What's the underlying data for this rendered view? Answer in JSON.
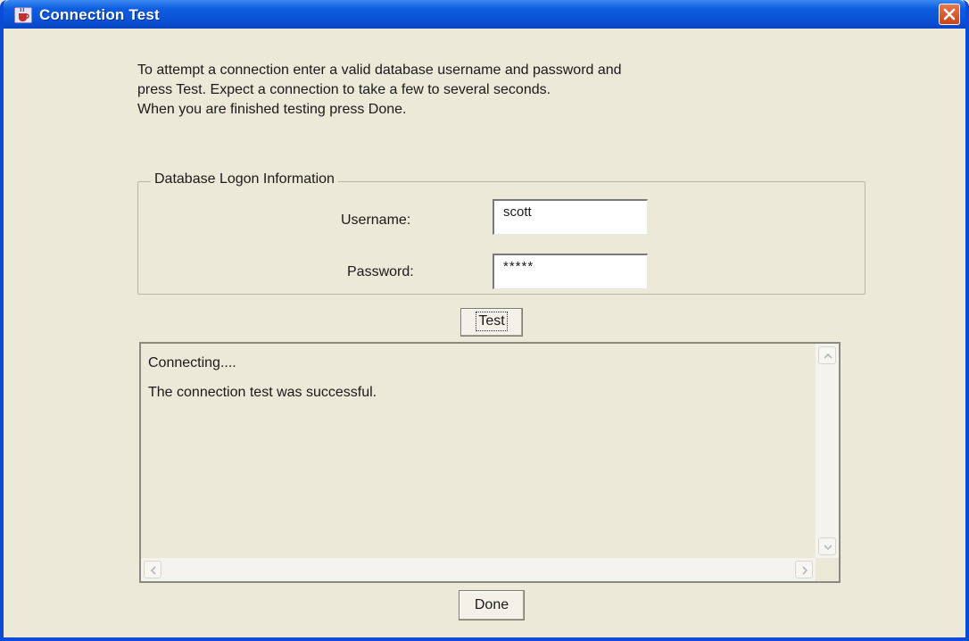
{
  "window": {
    "title": "Connection Test",
    "icons": {
      "app": "java-cup-icon",
      "close": "close-x-icon"
    },
    "colors": {
      "titlebar": "#0A52D6",
      "close": "#D5552B",
      "background": "#ECE9D8"
    }
  },
  "instructions": {
    "line1": "To attempt a connection enter a valid database username and password and",
    "line2": "press Test.  Expect a connection to take a few to several seconds.",
    "line3": "When you are finished testing press Done."
  },
  "logon": {
    "legend": "Database Logon Information",
    "username_label": "Username:",
    "username_value": "scott",
    "password_label": "Password:",
    "password_value": "*****"
  },
  "buttons": {
    "test": "Test",
    "done": "Done"
  },
  "output": {
    "line1": "Connecting....",
    "line2": "The connection test was successful."
  }
}
